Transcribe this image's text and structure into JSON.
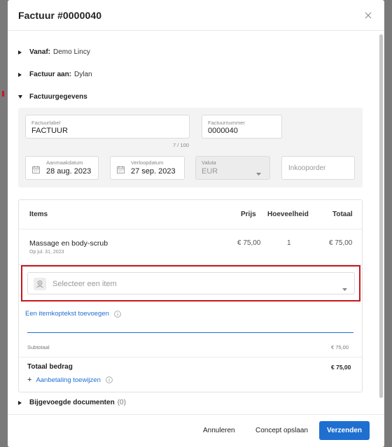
{
  "modal": {
    "title": "Factuur #0000040"
  },
  "sections": {
    "from": {
      "label": "Vanaf:",
      "value": "Demo Lincy"
    },
    "to": {
      "label": "Factuur aan:",
      "value": "Dylan"
    },
    "details": {
      "label": "Factuurgegevens"
    },
    "attachments": {
      "label": "Bijgevoegde documenten",
      "count": "(0)"
    }
  },
  "details": {
    "invoice_label": {
      "label": "Factuurlabel",
      "value": "FACTUUR",
      "counter": "7 / 100"
    },
    "invoice_number": {
      "label": "Factuurnummer",
      "value": "0000040"
    },
    "created_date": {
      "label": "Aanmaakdatum",
      "value": "28 aug. 2023"
    },
    "due_date": {
      "label": "Verloopdatum",
      "value": "27 sep. 2023"
    },
    "currency": {
      "label": "Valuta",
      "value": "EUR"
    },
    "purchase_order": {
      "placeholder": "Inkooporder"
    }
  },
  "items": {
    "headers": {
      "items": "Items",
      "price": "Prijs",
      "quantity": "Hoeveelheid",
      "total": "Totaal"
    },
    "rows": [
      {
        "name": "Massage en body-scrub",
        "date": "Op jul. 31, 2023",
        "price": "€ 75,00",
        "quantity": "1",
        "total": "€ 75,00"
      }
    ],
    "select_placeholder": "Selecteer een item",
    "add_header_link": "Een itemkoptekst toevoegen",
    "subtotal_label": "Subtotaal",
    "subtotal_value": "€ 75,00",
    "total_label": "Totaal bedrag",
    "total_value": "€ 75,00",
    "payment_link": "Aanbetaling toewijzen",
    "plus_symbol": "+"
  },
  "footer": {
    "cancel": "Annuleren",
    "save_draft": "Concept opslaan",
    "send": "Verzenden"
  },
  "colors": {
    "primary": "#1f6fd1",
    "highlight": "#c8161d"
  }
}
